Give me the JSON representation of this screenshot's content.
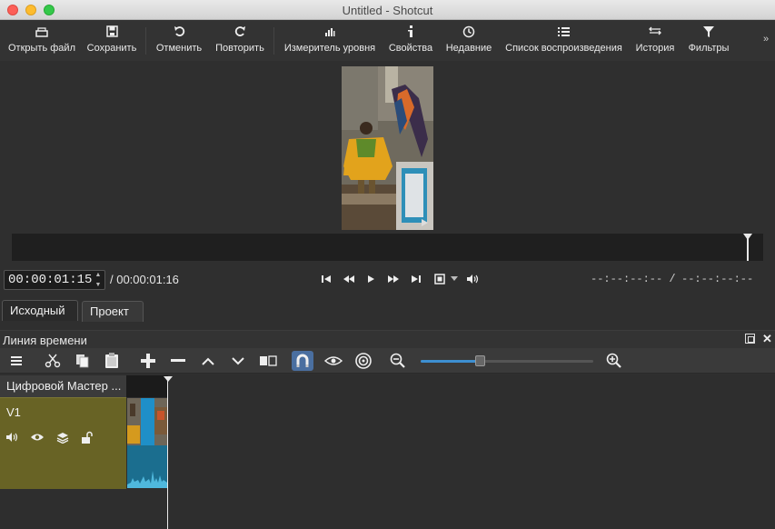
{
  "window": {
    "title": "Untitled - Shotcut"
  },
  "toolbar": {
    "items": [
      {
        "label": "Открыть файл",
        "icon": "open-file-icon"
      },
      {
        "label": "Сохранить",
        "icon": "save-icon"
      },
      {
        "label": "Отменить",
        "icon": "undo-icon"
      },
      {
        "label": "Повторить",
        "icon": "redo-icon"
      },
      {
        "label": "Измеритель уровня",
        "icon": "audio-meter-icon"
      },
      {
        "label": "Свойства",
        "icon": "info-icon"
      },
      {
        "label": "Недавние",
        "icon": "clock-icon"
      },
      {
        "label": "Список воспроизведения",
        "icon": "list-icon"
      },
      {
        "label": "История",
        "icon": "history-icon"
      },
      {
        "label": "Фильтры",
        "icon": "filter-icon"
      }
    ],
    "more": "»"
  },
  "player": {
    "timecode": "00:00:01:15",
    "duration": "/ 00:00:01:16",
    "in_point": "--:--:--:-- /",
    "out_point": "--:--:--:--",
    "playhead_position": 0.98
  },
  "tabs": {
    "source": "Исходный",
    "project": "Проект"
  },
  "splitter_grip": "......",
  "timeline": {
    "title": "Линия времени",
    "zoom_level": 0.34,
    "master_track": "Цифровой Мастер ...",
    "tracks": [
      {
        "name": "V1",
        "color": "#686325"
      }
    ]
  }
}
